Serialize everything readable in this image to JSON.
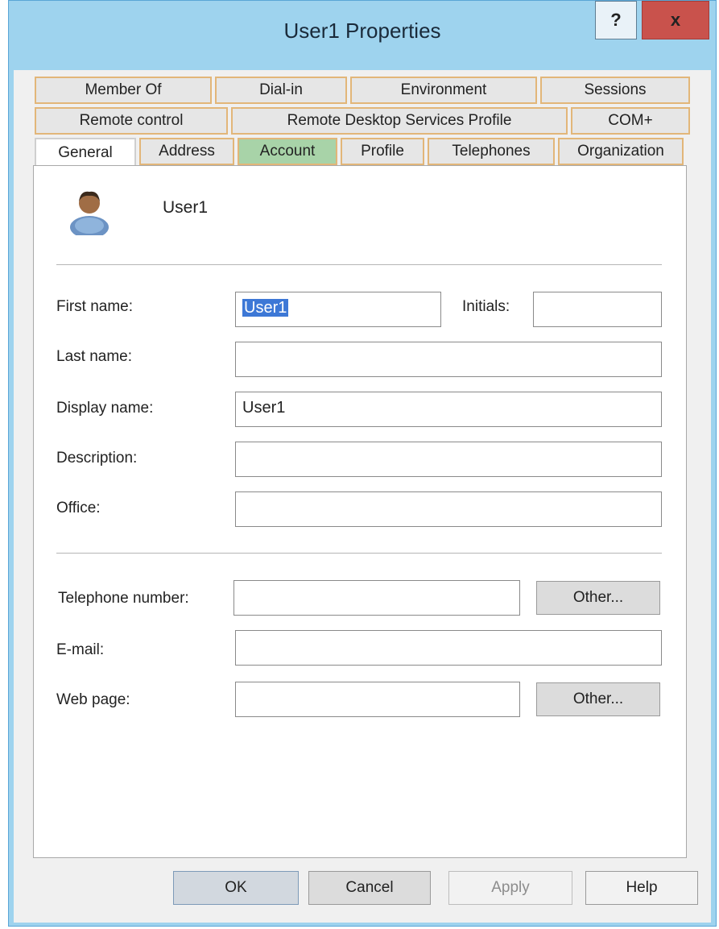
{
  "window": {
    "title": "User1 Properties",
    "help_label": "?",
    "close_label": "x"
  },
  "tabs": {
    "row1": [
      "Member Of",
      "Dial-in",
      "Environment",
      "Sessions"
    ],
    "row2": [
      "Remote control",
      "Remote Desktop Services Profile",
      "COM+"
    ],
    "row3": [
      "General",
      "Address",
      "Account",
      "Profile",
      "Telephones",
      "Organization"
    ],
    "active": "General"
  },
  "user": {
    "name": "User1",
    "icon": "user-icon"
  },
  "form": {
    "first_name_label": "First name:",
    "first_name_value": "User1",
    "initials_label": "Initials:",
    "initials_value": "",
    "last_name_label": "Last name:",
    "last_name_value": "",
    "display_name_label": "Display name:",
    "display_name_value": "User1",
    "description_label": "Description:",
    "description_value": "",
    "office_label": "Office:",
    "office_value": "",
    "telephone_label": "Telephone number:",
    "telephone_value": "",
    "email_label": "E-mail:",
    "email_value": "",
    "webpage_label": "Web page:",
    "webpage_value": "",
    "other_label": "Other..."
  },
  "buttons": {
    "ok": "OK",
    "cancel": "Cancel",
    "apply": "Apply",
    "help": "Help"
  },
  "colors": {
    "titlebar": "#9ed3ee",
    "close": "#c9524c",
    "tab_border": "#e2b679",
    "highlight_tab": "#a8d3a8"
  }
}
